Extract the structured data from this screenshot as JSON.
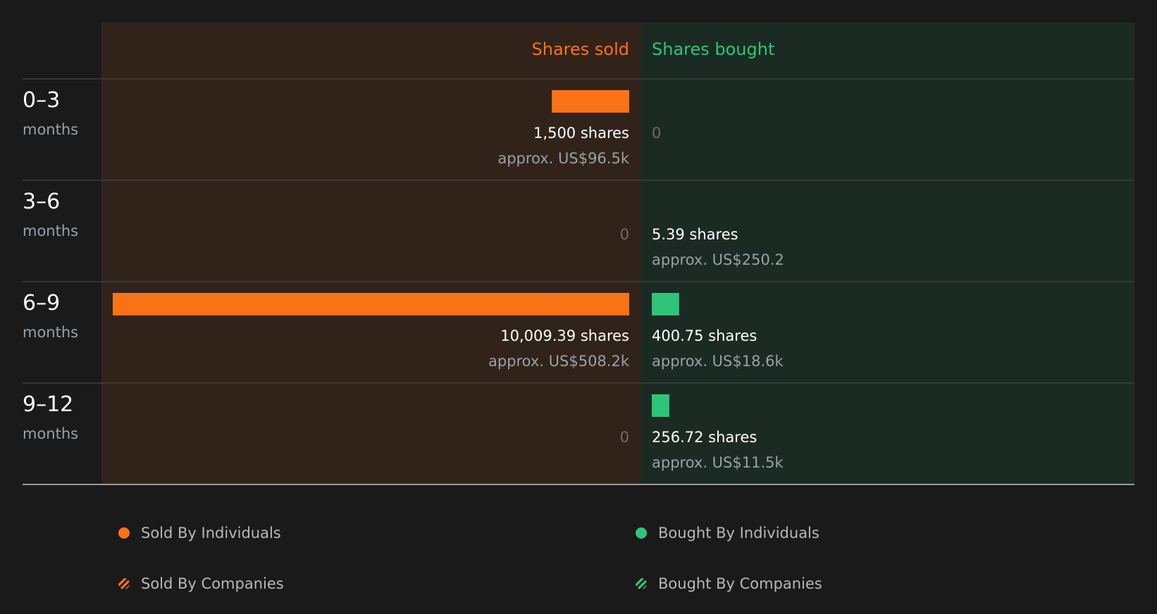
{
  "colors": {
    "background": "#1a1a1a",
    "sold_panel": "#32231a",
    "bought_panel": "#1b2b24",
    "sold_accent": "#f97316",
    "bought_accent": "#2ec57a",
    "text_primary": "#ffffff",
    "text_secondary": "#9aa0a6",
    "zero_text": "#6b6b6b",
    "divider": "#3e3e3e",
    "baseline": "#9a9a9a"
  },
  "chart_data": {
    "type": "bar",
    "orientation": "horizontal-diverging",
    "headers": {
      "sold": "Shares sold",
      "bought": "Shares bought"
    },
    "categories": [
      "0–3",
      "3–6",
      "6–9",
      "9–12"
    ],
    "category_unit": "months",
    "series": [
      {
        "name": "Shares sold",
        "values": [
          1500,
          0,
          10009.39
        ],
        "labels": [
          "1,500 shares",
          "0",
          "10,009.39 shares",
          "0"
        ],
        "approx": [
          "approx. US$96.5k",
          "",
          "approx. US$508.2k",
          ""
        ]
      },
      {
        "name": "Shares bought",
        "values": [
          0,
          5.39,
          400.75,
          256.72
        ],
        "labels": [
          "0",
          "5.39 shares",
          "400.75 shares",
          "256.72 shares"
        ],
        "approx": [
          "",
          "approx. US$250.2",
          "approx. US$18.6k",
          "approx. US$11.5k"
        ]
      }
    ],
    "legend": {
      "placement": "bottom",
      "items": [
        {
          "label": "Sold By Individuals",
          "style": "solid",
          "color": "#f97316"
        },
        {
          "label": "Bought By Individuals",
          "style": "solid",
          "color": "#2ec57a"
        },
        {
          "label": "Sold By Companies",
          "style": "hatched",
          "color": "#f97316"
        },
        {
          "label": "Bought By Companies",
          "style": "hatched",
          "color": "#2ec57a"
        }
      ]
    }
  }
}
